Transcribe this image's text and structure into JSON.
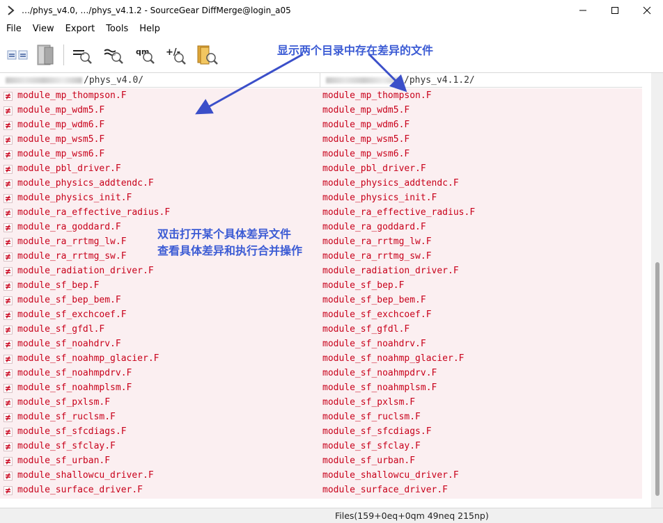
{
  "window": {
    "title": "…/phys_v4.0, …/phys_v4.1.2 - SourceGear DiffMerge@login_a05",
    "minimize_glyph": "—",
    "maximize_glyph": "☐",
    "close_glyph": "✕"
  },
  "menu": [
    "File",
    "View",
    "Export",
    "Tools",
    "Help"
  ],
  "toolbar": {
    "buttons": [
      {
        "icon": "compare-equal-icon"
      },
      {
        "icon": "folder-panel-icon"
      },
      {
        "icon": "show-equal-icon"
      },
      {
        "icon": "show-different-icon"
      },
      {
        "icon": "show-qm-icon"
      },
      {
        "icon": "show-added-removed-icon"
      },
      {
        "icon": "folder-search-icon"
      }
    ],
    "qm_label": "qm",
    "plusminus_label": "+/-"
  },
  "columns": {
    "left_path": "/phys_v4.0/",
    "right_path": "/phys_v4.1.2/"
  },
  "files": [
    "module_mp_thompson.F",
    "module_mp_wdm5.F",
    "module_mp_wdm6.F",
    "module_mp_wsm5.F",
    "module_mp_wsm6.F",
    "module_pbl_driver.F",
    "module_physics_addtendc.F",
    "module_physics_init.F",
    "module_ra_effective_radius.F",
    "module_ra_goddard.F",
    "module_ra_rrtmg_lw.F",
    "module_ra_rrtmg_sw.F",
    "module_radiation_driver.F",
    "module_sf_bep.F",
    "module_sf_bep_bem.F",
    "module_sf_exchcoef.F",
    "module_sf_gfdl.F",
    "module_sf_noahdrv.F",
    "module_sf_noahmp_glacier.F",
    "module_sf_noahmpdrv.F",
    "module_sf_noahmplsm.F",
    "module_sf_pxlsm.F",
    "module_sf_ruclsm.F",
    "module_sf_sfcdiags.F",
    "module_sf_sfclay.F",
    "module_sf_urban.F",
    "module_shallowcu_driver.F",
    "module_surface_driver.F"
  ],
  "status": "Files(159+0eq+0qm 49neq 215np)",
  "annotations": {
    "top": "显示两个目录中存在差异的文件",
    "middle_line1": "双击打开某个具体差异文件",
    "middle_line2": "查看具体差异和执行合并操作"
  },
  "colors": {
    "diff_text": "#c8001a",
    "diff_row_bg": "#fbeff1",
    "annotation": "#3b5bd4"
  }
}
